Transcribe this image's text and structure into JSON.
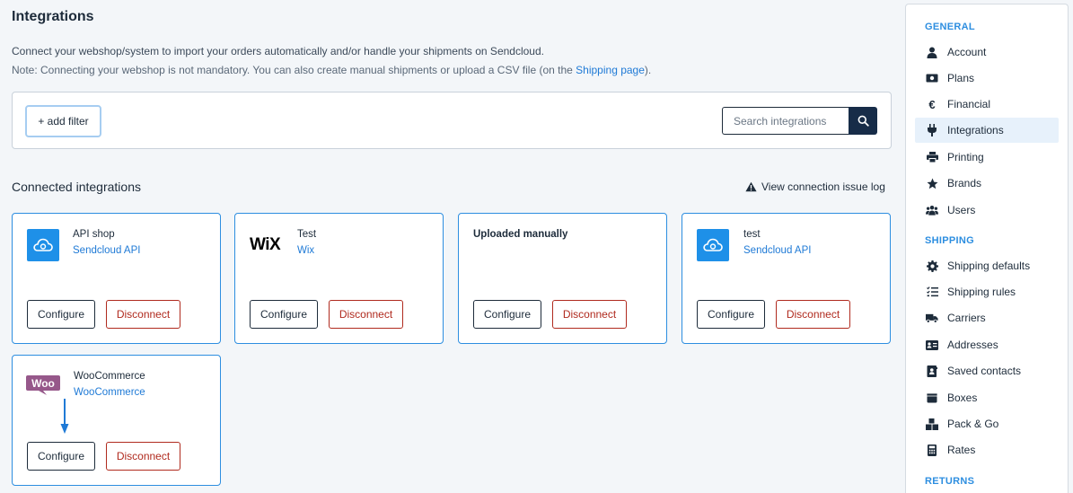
{
  "header": {
    "title": "Integrations",
    "description": "Connect your webshop/system to import your orders automatically and/or handle your shipments on Sendcloud.",
    "note_prefix": "Note: Connecting your webshop is not mandatory. You can also create manual shipments or upload a CSV file (on the ",
    "note_link": "Shipping page",
    "note_suffix": ")."
  },
  "filter": {
    "add_filter_label": "+ add filter",
    "search_placeholder": "Search integrations"
  },
  "connected": {
    "title": "Connected integrations",
    "issue_log_label": "View connection issue log",
    "cards": [
      {
        "name": "API shop",
        "subtitle": "Sendcloud API",
        "logo": "sendcloud-cloud-icon",
        "configure": "Configure",
        "disconnect": "Disconnect"
      },
      {
        "name": "Test",
        "subtitle": "Wix",
        "logo": "wix-logo",
        "logo_text": "WiX",
        "configure": "Configure",
        "disconnect": "Disconnect"
      },
      {
        "name": "Uploaded manually",
        "subtitle": "",
        "logo": "",
        "configure": "Configure",
        "disconnect": "Disconnect"
      },
      {
        "name": "test",
        "subtitle": "Sendcloud API",
        "logo": "sendcloud-cloud-icon",
        "configure": "Configure",
        "disconnect": "Disconnect"
      },
      {
        "name": "WooCommerce",
        "subtitle": "WooCommerce",
        "logo": "woocommerce-logo",
        "logo_text": "Woo",
        "configure": "Configure",
        "disconnect": "Disconnect"
      }
    ]
  },
  "sidebar": {
    "sections": [
      {
        "heading": "GENERAL",
        "items": [
          {
            "label": "Account",
            "icon": "user-icon"
          },
          {
            "label": "Plans",
            "icon": "money-icon"
          },
          {
            "label": "Financial",
            "icon": "euro-icon"
          },
          {
            "label": "Integrations",
            "icon": "plug-icon",
            "active": true
          },
          {
            "label": "Printing",
            "icon": "printer-icon"
          },
          {
            "label": "Brands",
            "icon": "star-icon"
          },
          {
            "label": "Users",
            "icon": "users-icon"
          }
        ]
      },
      {
        "heading": "SHIPPING",
        "items": [
          {
            "label": "Shipping defaults",
            "icon": "gear-icon"
          },
          {
            "label": "Shipping rules",
            "icon": "list-check-icon"
          },
          {
            "label": "Carriers",
            "icon": "truck-icon"
          },
          {
            "label": "Addresses",
            "icon": "address-card-icon"
          },
          {
            "label": "Saved contacts",
            "icon": "contact-book-icon"
          },
          {
            "label": "Boxes",
            "icon": "box-icon"
          },
          {
            "label": "Pack & Go",
            "icon": "boxes-icon"
          },
          {
            "label": "Rates",
            "icon": "calculator-icon"
          }
        ]
      },
      {
        "heading": "RETURNS",
        "items": []
      }
    ]
  },
  "colors": {
    "accent": "#2d8ee0",
    "link": "#1f7ad6",
    "navy": "#172c48",
    "danger": "#b02a1e",
    "woo_purple": "#96588a"
  }
}
